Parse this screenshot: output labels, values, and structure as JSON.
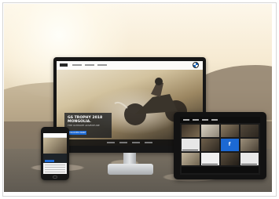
{
  "page": {
    "description": ""
  },
  "monitor": {
    "hero_title": "GS TROPHY 2018\nMONGOLIA.",
    "hero_subtitle": "THE ULTIMATE ADVENTURE",
    "hero_button": "DISCOVER MORE"
  },
  "tablet": {
    "social_icon": "f"
  },
  "colors": {
    "accent": "#1c69d4",
    "dark": "#161616"
  },
  "icons": [
    "bmw-logo-icon",
    "facebook-icon"
  ]
}
